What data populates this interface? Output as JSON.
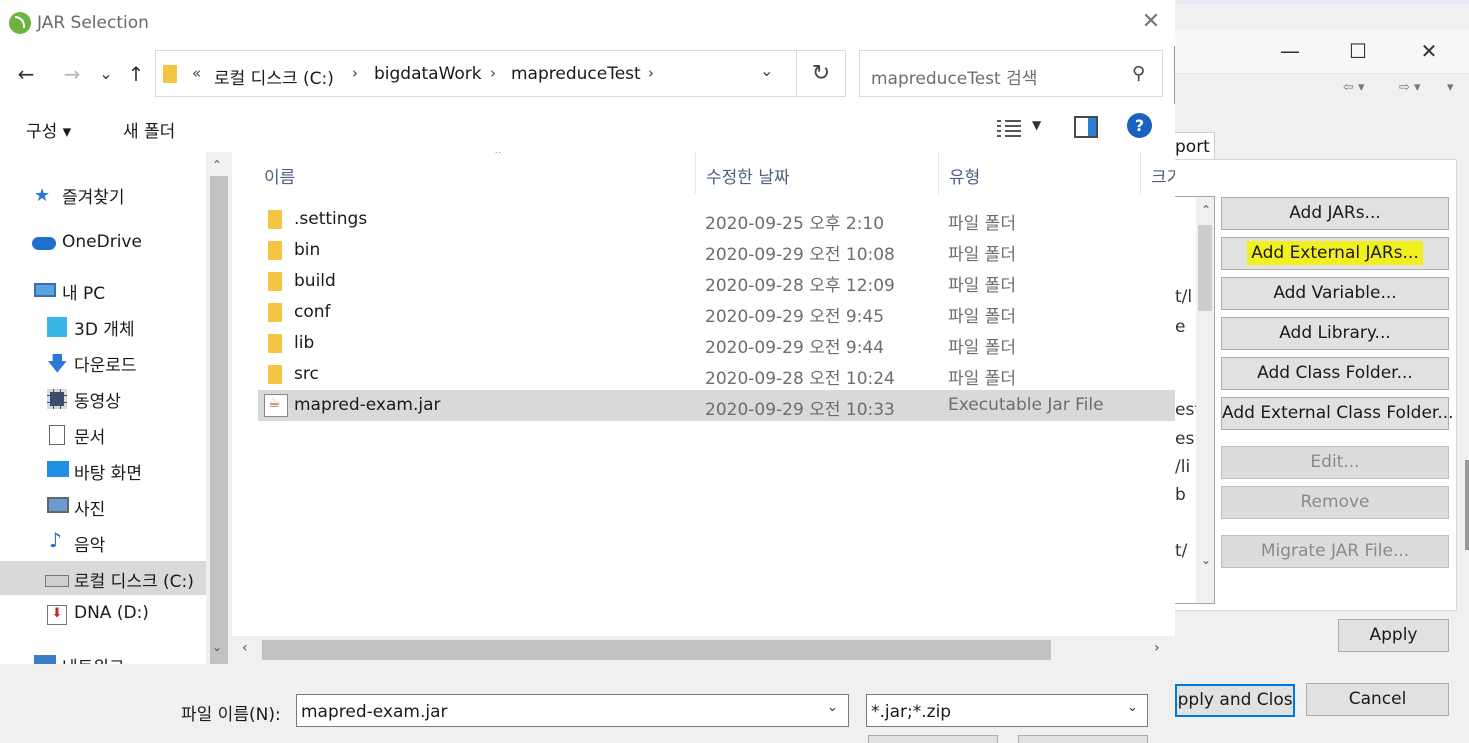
{
  "dialog": {
    "title": "JAR Selection",
    "close_glyph": "✕",
    "nav": {
      "back": "←",
      "forward": "→",
      "recent": "⌄",
      "up": "↑"
    },
    "address": {
      "overflow": "«",
      "crumbs": [
        "로컬 디스크 (C:)",
        "bigdataWork",
        "mapreduceTest"
      ],
      "separator": "›",
      "dropdown": "⌄"
    },
    "refresh_glyph": "↻",
    "search": {
      "placeholder": "mapreduceTest 검색",
      "icon": "⚲"
    },
    "commands": {
      "organize": "구성 ▾",
      "new_folder": "새 폴더",
      "help": "?"
    },
    "nav_pane": [
      {
        "label": "즐겨찾기",
        "icon": "star-icon"
      },
      {
        "label": "OneDrive",
        "icon": "cloud-icon"
      },
      {
        "label": "내 PC",
        "icon": "pc-icon"
      },
      {
        "label": "3D 개체",
        "icon": "cube-icon"
      },
      {
        "label": "다운로드",
        "icon": "download-icon"
      },
      {
        "label": "동영상",
        "icon": "video-icon"
      },
      {
        "label": "문서",
        "icon": "document-icon"
      },
      {
        "label": "바탕 화면",
        "icon": "desktop-icon"
      },
      {
        "label": "사진",
        "icon": "picture-icon"
      },
      {
        "label": "음악",
        "icon": "music-icon"
      },
      {
        "label": "로컬 디스크 (C:)",
        "icon": "drive-icon",
        "selected": true
      },
      {
        "label": "DNA (D:)",
        "icon": "drive-icon"
      },
      {
        "label": "네트워크",
        "icon": "network-icon"
      }
    ],
    "columns": [
      "이름",
      "수정한 날짜",
      "유형",
      "크기"
    ],
    "files": [
      {
        "name": ".settings",
        "date": "2020-09-25 오후 2:10",
        "type": "파일 폴더",
        "kind": "folder"
      },
      {
        "name": "bin",
        "date": "2020-09-29 오전 10:08",
        "type": "파일 폴더",
        "kind": "folder"
      },
      {
        "name": "build",
        "date": "2020-09-28 오후 12:09",
        "type": "파일 폴더",
        "kind": "folder"
      },
      {
        "name": "conf",
        "date": "2020-09-29 오전 9:45",
        "type": "파일 폴더",
        "kind": "folder"
      },
      {
        "name": "lib",
        "date": "2020-09-29 오전 9:44",
        "type": "파일 폴더",
        "kind": "folder"
      },
      {
        "name": "src",
        "date": "2020-09-28 오전 10:24",
        "type": "파일 폴더",
        "kind": "folder"
      },
      {
        "name": "mapred-exam.jar",
        "date": "2020-09-29 오전 10:33",
        "type": "Executable Jar File",
        "kind": "jar",
        "selected": true
      }
    ],
    "filename_label": "파일 이름(N):",
    "filename_value": "mapred-exam.jar",
    "filetype_value": "*.jar;*.zip"
  },
  "background_window": {
    "tab_fragment": "port",
    "window_controls": {
      "minimize": "—",
      "maximize": "☐",
      "close": "✕"
    },
    "list_fragments": [
      "t/l",
      "e",
      "est",
      "es",
      "/li",
      "b",
      "t/"
    ],
    "buttons": [
      {
        "label": "Add JARs...",
        "enabled": true
      },
      {
        "label": "Add External JARs...",
        "enabled": true,
        "highlighted": true
      },
      {
        "label": "Add Variable...",
        "enabled": true
      },
      {
        "label": "Add Library...",
        "enabled": true
      },
      {
        "label": "Add Class Folder...",
        "enabled": true
      },
      {
        "label": "Add External Class Folder...",
        "enabled": true
      },
      {
        "label": "Edit...",
        "enabled": false
      },
      {
        "label": "Remove",
        "enabled": false
      },
      {
        "label": "Migrate JAR File...",
        "enabled": false
      }
    ],
    "apply": "Apply",
    "apply_and_close": "Apply and Close",
    "cancel": "Cancel"
  }
}
